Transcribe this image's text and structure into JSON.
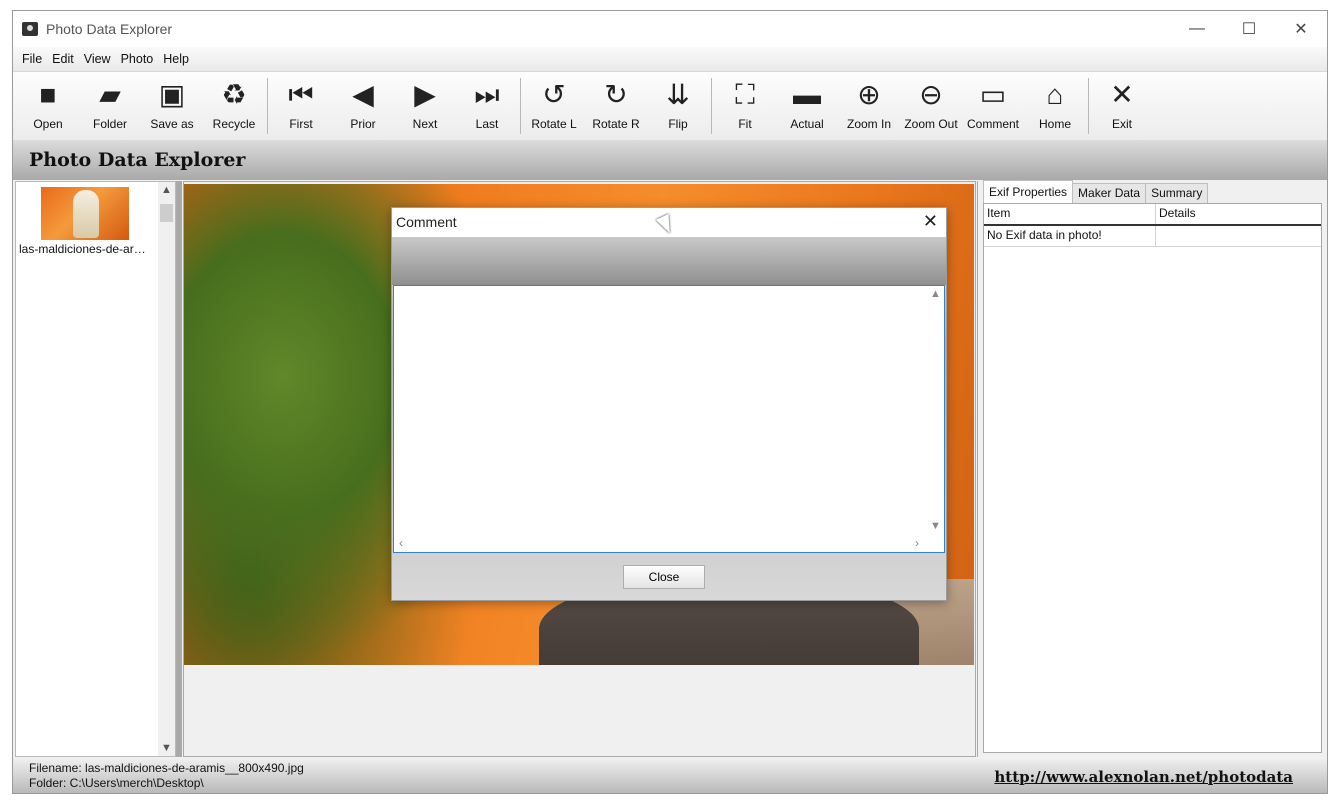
{
  "window": {
    "title": "Photo Data Explorer",
    "controls": [
      "—",
      "☐",
      "✕"
    ]
  },
  "menu": [
    "File",
    "Edit",
    "View",
    "Photo",
    "Help"
  ],
  "toolbar": [
    {
      "label": "Open",
      "icon": "■"
    },
    {
      "label": "Folder",
      "icon": "▰"
    },
    {
      "label": "Save as",
      "icon": "▣"
    },
    {
      "label": "Recycle",
      "icon": "♻"
    },
    {
      "label": "First",
      "icon": "⏮"
    },
    {
      "label": "Prior",
      "icon": "◀"
    },
    {
      "label": "Next",
      "icon": "▶"
    },
    {
      "label": "Last",
      "icon": "⏭"
    },
    {
      "label": "Rotate L",
      "icon": "↺"
    },
    {
      "label": "Rotate R",
      "icon": "↻"
    },
    {
      "label": "Flip",
      "icon": "⇊"
    },
    {
      "label": "Fit",
      "icon": "⛶"
    },
    {
      "label": "Actual",
      "icon": "▬"
    },
    {
      "label": "Zoom In",
      "icon": "⊕"
    },
    {
      "label": "Zoom Out",
      "icon": "⊖"
    },
    {
      "label": "Comment",
      "icon": "▭"
    },
    {
      "label": "Home",
      "icon": "⌂"
    },
    {
      "label": "Exit",
      "icon": "✕"
    }
  ],
  "header": {
    "title": "Photo Data Explorer"
  },
  "thumbnails": [
    {
      "label": "las-maldiciones-de-ar…"
    }
  ],
  "right_panel": {
    "tabs": [
      "Exif Properties",
      "Maker Data",
      "Summary"
    ],
    "columns": [
      "Item",
      "Details"
    ],
    "rows": [
      [
        "No Exif data in photo!",
        ""
      ]
    ]
  },
  "status": {
    "filename": "Filename: las-maldiciones-de-aramis__800x490.jpg",
    "folder": "Folder: C:\\Users\\merch\\Desktop\\",
    "link": "http://www.alexnolan.net/photodata"
  },
  "dialog": {
    "title": "Comment",
    "close_icon": "✕",
    "text": "",
    "button": "Close"
  }
}
